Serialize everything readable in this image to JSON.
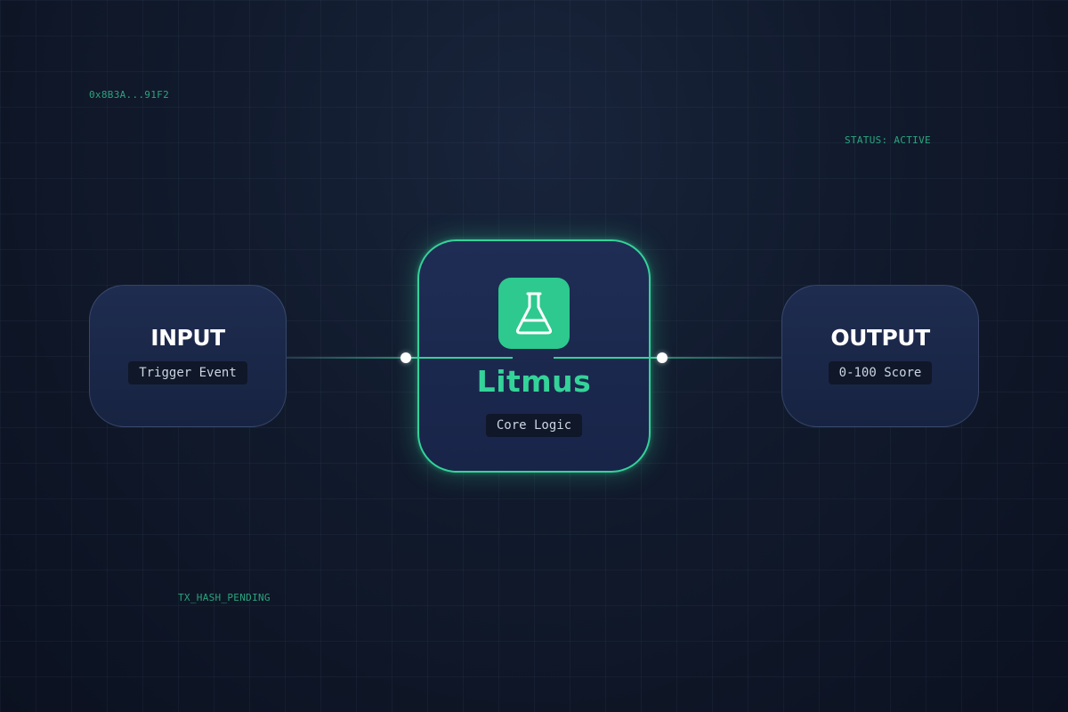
{
  "labels": {
    "address": "0x8B3A...91F2",
    "status": "STATUS: ACTIVE",
    "tx": "TX_HASH_PENDING"
  },
  "nodes": {
    "input": {
      "title": "INPUT",
      "tag": "Trigger Event"
    },
    "core": {
      "title": "Litmus",
      "tag": "Core Logic",
      "icon": "flask-icon"
    },
    "output": {
      "title": "OUTPUT",
      "tag": "0-100 Score"
    }
  },
  "colors": {
    "accent": "#34d399",
    "icon_bg": "#2ec98e",
    "node_bg": "#1e2c50",
    "background": "#111a2c"
  }
}
